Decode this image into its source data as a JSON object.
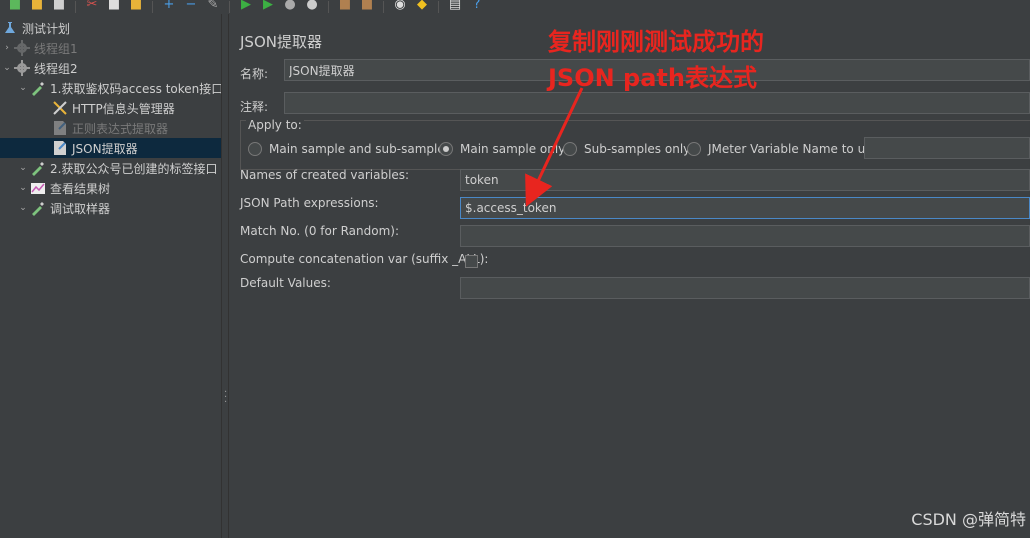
{
  "tree": {
    "items": [
      {
        "label": "测试计划",
        "level": 0,
        "icon": "test-plan-icon",
        "disabled": false,
        "selected": false
      },
      {
        "label": "线程组1",
        "level": 1,
        "icon": "gear-icon",
        "disabled": true,
        "selected": false
      },
      {
        "label": "线程组2",
        "level": 1,
        "icon": "gear-icon",
        "disabled": false,
        "selected": false
      },
      {
        "label": "1.获取鉴权码access token接口",
        "level": 2,
        "icon": "pipette-icon",
        "disabled": false,
        "selected": false
      },
      {
        "label": "HTTP信息头管理器",
        "level": 3,
        "icon": "tools-icon",
        "disabled": false,
        "selected": false
      },
      {
        "label": "正则表达式提取器",
        "level": 3,
        "icon": "extractor-icon",
        "disabled": true,
        "selected": false
      },
      {
        "label": "JSON提取器",
        "level": 3,
        "icon": "extractor-icon",
        "disabled": false,
        "selected": true
      },
      {
        "label": "2.获取公众号已创建的标签接口",
        "level": 2,
        "icon": "pipette-icon",
        "disabled": false,
        "selected": false
      },
      {
        "label": "查看结果树",
        "level": 2,
        "icon": "chart-icon",
        "disabled": false,
        "selected": false
      },
      {
        "label": "调试取样器",
        "level": 2,
        "icon": "pipette-icon",
        "disabled": false,
        "selected": false
      }
    ]
  },
  "panel": {
    "title": "JSON提取器",
    "name_label": "名称:",
    "name_value": "JSON提取器",
    "comment_label": "注释:",
    "comment_value": "",
    "apply_to": {
      "legend": "Apply to:",
      "options": [
        {
          "label": "Main sample and sub-samples",
          "checked": false
        },
        {
          "label": "Main sample only",
          "checked": true
        },
        {
          "label": "Sub-samples only",
          "checked": false
        },
        {
          "label": "JMeter Variable Name to use",
          "checked": false
        }
      ],
      "variable_value": ""
    },
    "names_label": "Names of created variables:",
    "names_value": "token",
    "path_label": "JSON Path expressions:",
    "path_value": "$.access_token",
    "match_label": "Match No. (0 for Random):",
    "match_value": "",
    "concat_label": "Compute concatenation var (suffix _ALL):",
    "concat_checked": false,
    "default_label": "Default Values:",
    "default_value": ""
  },
  "annotation": {
    "line1": "复制刚刚测试成功的",
    "line2": "JSON path表达式",
    "color": "#e8251f"
  },
  "watermark": "CSDN @弹简特"
}
